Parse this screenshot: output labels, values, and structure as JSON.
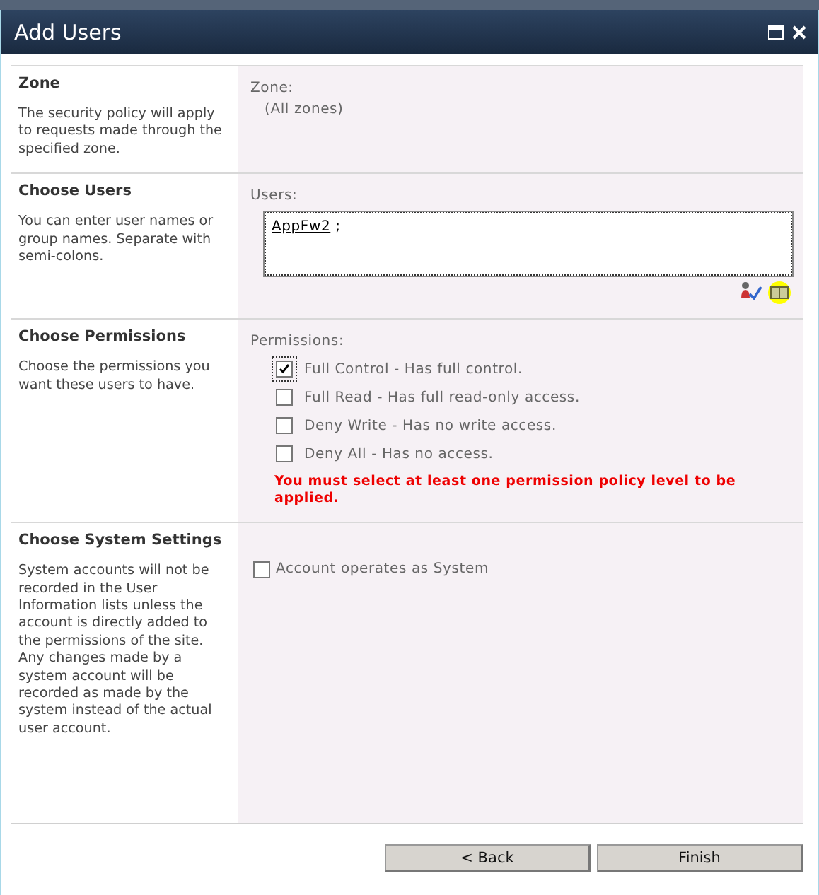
{
  "dialog": {
    "title": "Add Users"
  },
  "sections": [
    {
      "kind": "zone",
      "heading": "Zone",
      "description": "The security policy will apply to requests made through the specified zone.",
      "label": "Zone:",
      "value": "(All zones)"
    },
    {
      "kind": "users",
      "heading": "Choose Users",
      "description": "You can enter user names or group names. Separate with semi-colons.",
      "label": "Users:",
      "user": "AppFw2",
      "separator": ";"
    },
    {
      "kind": "permissions",
      "heading": "Choose Permissions",
      "description": "Choose the permissions you want these users to have.",
      "label": "Permissions:",
      "options": [
        {
          "label": "Full Control - Has full control.",
          "checked": true
        },
        {
          "label": "Full Read - Has full read-only access.",
          "checked": false
        },
        {
          "label": "Deny Write - Has no write access.",
          "checked": false
        },
        {
          "label": "Deny All - Has no access.",
          "checked": false
        }
      ],
      "error": "You must select at least one permission policy level to be applied."
    },
    {
      "kind": "system",
      "heading": "Choose System Settings",
      "description": "System accounts will not be recorded in the User Information lists unless the account is directly added to the permissions of the site. Any changes made by a system account will be recorded as made by the system instead of the actual user account.",
      "option": {
        "label": "Account operates as System",
        "checked": false
      }
    }
  ],
  "buttons": [
    "< Back",
    "Finish"
  ]
}
